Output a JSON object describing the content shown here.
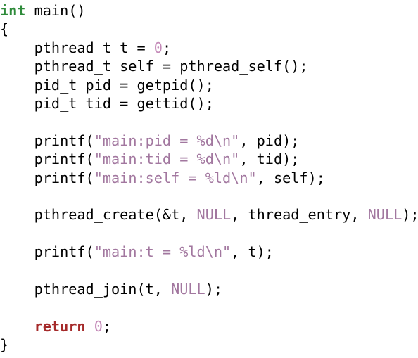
{
  "colors": {
    "keyword_type": "#2e8b3a",
    "keyword_control": "#a52a2a",
    "string": "#a2779f",
    "number": "#c48ab8",
    "constant": "#a2779f",
    "text": "#000000",
    "background": "#ffffff"
  },
  "code": {
    "lines": [
      [
        {
          "t": "int",
          "c": "kw"
        },
        {
          "t": " main()",
          "c": ""
        }
      ],
      [
        {
          "t": "{",
          "c": ""
        }
      ],
      [
        {
          "t": "    pthread_t t = ",
          "c": ""
        },
        {
          "t": "0",
          "c": "num"
        },
        {
          "t": ";",
          "c": ""
        }
      ],
      [
        {
          "t": "    pthread_t self = pthread_self();",
          "c": ""
        }
      ],
      [
        {
          "t": "    pid_t pid = getpid();",
          "c": ""
        }
      ],
      [
        {
          "t": "    pid_t tid = gettid();",
          "c": ""
        }
      ],
      [
        {
          "t": "",
          "c": ""
        }
      ],
      [
        {
          "t": "    printf(",
          "c": ""
        },
        {
          "t": "\"main:pid = %d\\n\"",
          "c": "str"
        },
        {
          "t": ", pid);",
          "c": ""
        }
      ],
      [
        {
          "t": "    printf(",
          "c": ""
        },
        {
          "t": "\"main:tid = %d\\n\"",
          "c": "str"
        },
        {
          "t": ", tid);",
          "c": ""
        }
      ],
      [
        {
          "t": "    printf(",
          "c": ""
        },
        {
          "t": "\"main:self = %ld\\n\"",
          "c": "str"
        },
        {
          "t": ", self);",
          "c": ""
        }
      ],
      [
        {
          "t": "",
          "c": ""
        }
      ],
      [
        {
          "t": "    pthread_create(&t, ",
          "c": ""
        },
        {
          "t": "NULL",
          "c": "nul"
        },
        {
          "t": ", thread_entry, ",
          "c": ""
        },
        {
          "t": "NULL",
          "c": "nul"
        },
        {
          "t": ");",
          "c": ""
        }
      ],
      [
        {
          "t": "",
          "c": ""
        }
      ],
      [
        {
          "t": "    printf(",
          "c": ""
        },
        {
          "t": "\"main:t = %ld\\n\"",
          "c": "str"
        },
        {
          "t": ", t);",
          "c": ""
        }
      ],
      [
        {
          "t": "",
          "c": ""
        }
      ],
      [
        {
          "t": "    pthread_join(t, ",
          "c": ""
        },
        {
          "t": "NULL",
          "c": "nul"
        },
        {
          "t": ");",
          "c": ""
        }
      ],
      [
        {
          "t": "",
          "c": ""
        }
      ],
      [
        {
          "t": "    ",
          "c": ""
        },
        {
          "t": "return",
          "c": "ret"
        },
        {
          "t": " ",
          "c": ""
        },
        {
          "t": "0",
          "c": "num"
        },
        {
          "t": ";",
          "c": ""
        }
      ],
      [
        {
          "t": "}",
          "c": ""
        }
      ]
    ]
  }
}
